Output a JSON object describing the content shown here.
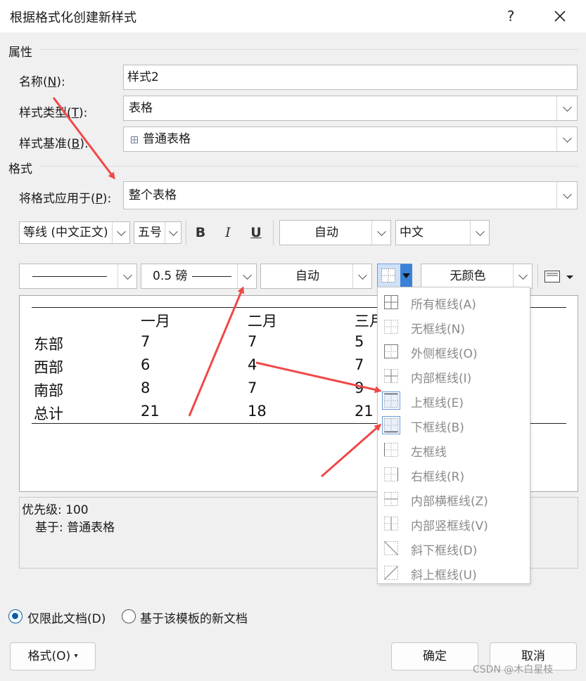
{
  "window": {
    "title": "根据格式化创建新样式",
    "help": "?",
    "close": "✕"
  },
  "properties": {
    "heading": "属性",
    "name_label": "名称(N):",
    "name_value": "样式2",
    "type_label": "样式类型(T):",
    "type_value": "表格",
    "base_label": "样式基准(B):",
    "base_value": "普通表格"
  },
  "format": {
    "heading": "格式",
    "apply_label": "将格式应用于(P):",
    "apply_value": "整个表格",
    "font": "等线 (中文正文)",
    "size": "五号",
    "bold": "B",
    "italic": "I",
    "underline": "U",
    "color": "自动",
    "script": "中文",
    "line_style": "",
    "line_weight": "0.5 磅",
    "border_color": "自动",
    "shading": "无颜色"
  },
  "preview": {
    "headers": [
      "",
      "一月",
      "二月",
      "三月"
    ],
    "rows": [
      [
        "东部",
        "7",
        "7",
        "5"
      ],
      [
        "西部",
        "6",
        "4",
        "7"
      ],
      [
        "南部",
        "8",
        "7",
        "9"
      ],
      [
        "总计",
        "21",
        "18",
        "21"
      ]
    ]
  },
  "border_menu": [
    {
      "label": "所有框线(A)",
      "icon": "all-borders-icon"
    },
    {
      "label": "无框线(N)",
      "icon": "no-border-icon"
    },
    {
      "label": "外侧框线(O)",
      "icon": "outside-borders-icon"
    },
    {
      "label": "内部框线(I)",
      "icon": "inside-borders-icon"
    },
    {
      "label": "上框线(E)",
      "icon": "top-border-icon"
    },
    {
      "label": "下框线(B)",
      "icon": "bottom-border-icon"
    },
    {
      "label": "左框线",
      "icon": "left-border-icon"
    },
    {
      "label": "右框线(R)",
      "icon": "right-border-icon"
    },
    {
      "label": "内部横框线(Z)",
      "icon": "inside-horizontal-border-icon"
    },
    {
      "label": "内部竖框线(V)",
      "icon": "inside-vertical-border-icon"
    },
    {
      "label": "斜下框线(D)",
      "icon": "diagonal-down-border-icon"
    },
    {
      "label": "斜上框线(U)",
      "icon": "diagonal-up-border-icon"
    }
  ],
  "description": {
    "priority": "优先级: 100",
    "based_on": "基于: 普通表格"
  },
  "scope": {
    "this_doc": "仅限此文档(D)",
    "template": "基于该模板的新文档"
  },
  "buttons": {
    "format": "格式(O)",
    "ok": "确定",
    "cancel": "取消"
  },
  "watermark": "CSDN @木白星枝",
  "colors": {
    "accent": "#0b5cad",
    "arrow": "#f04848"
  }
}
